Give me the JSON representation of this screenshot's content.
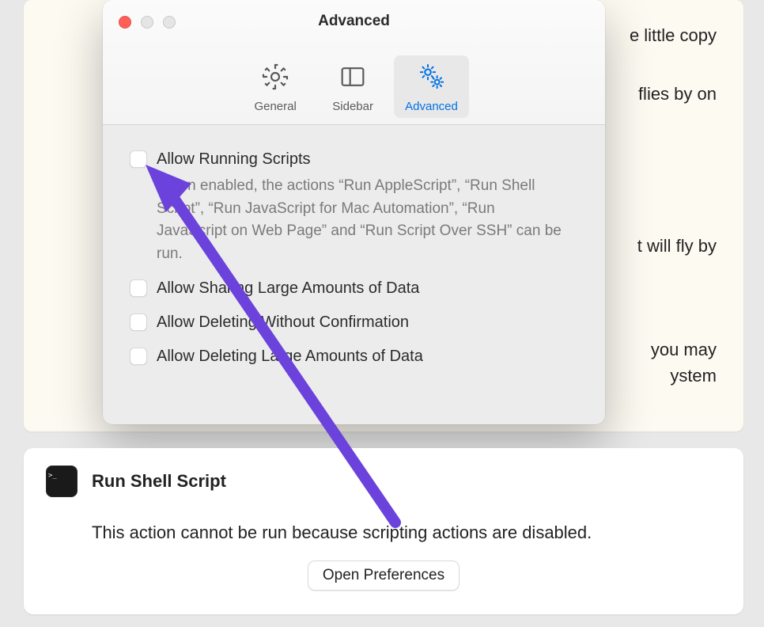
{
  "background": {
    "line1": "e little copy",
    "line2": "flies by on",
    "line3": "t will fly by",
    "line4": "you may",
    "line5": "ystem"
  },
  "window": {
    "title": "Advanced",
    "tabs": {
      "general": "General",
      "sidebar": "Sidebar",
      "advanced": "Advanced"
    },
    "options": {
      "allow_scripts": {
        "title": "Allow Running Scripts",
        "desc": "When enabled, the actions “Run AppleScript”, “Run Shell Script”, “Run JavaScript for Mac Automation”, “Run JavaScript on Web Page” and “Run Script Over SSH” can be run."
      },
      "allow_sharing": {
        "title": "Allow Sharing Large Amounts of Data"
      },
      "allow_delete_noconfirm": {
        "title": "Allow Deleting Without Confirmation"
      },
      "allow_delete_large": {
        "title": "Allow Deleting Large Amounts of Data"
      }
    }
  },
  "error_card": {
    "title": "Run Shell Script",
    "message": "This action cannot be run because scripting actions are disabled.",
    "button": "Open Preferences"
  }
}
